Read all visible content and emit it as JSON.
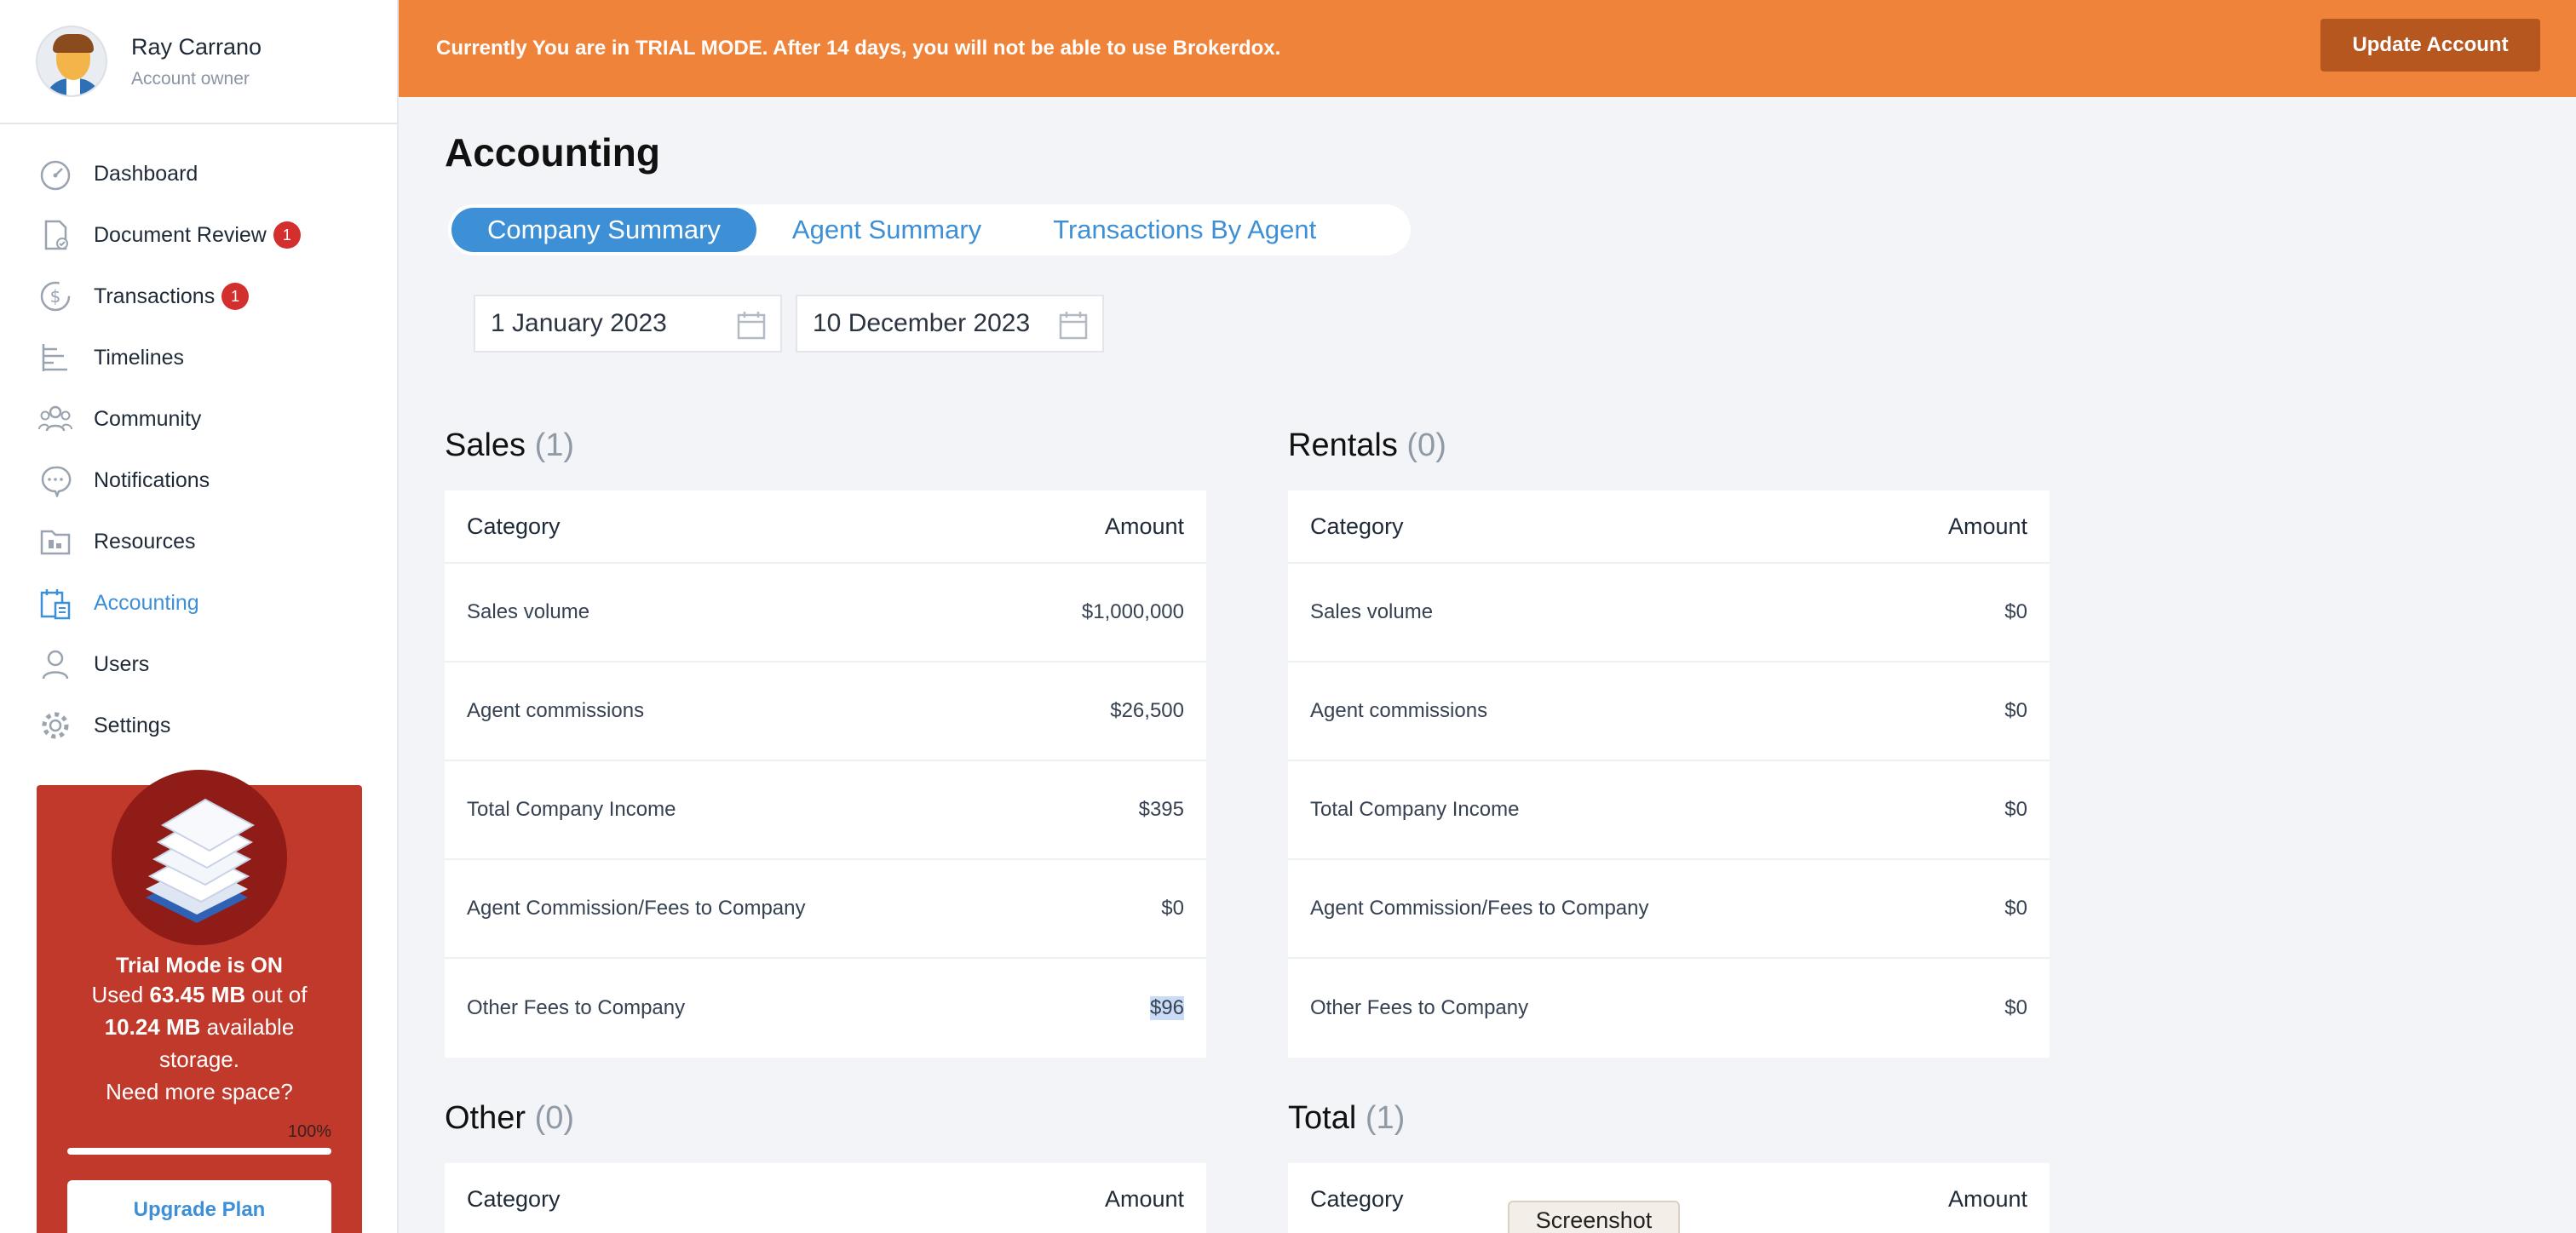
{
  "profile": {
    "name": "Ray Carrano",
    "role": "Account owner"
  },
  "nav": [
    {
      "label": "Dashboard",
      "icon": "speedometer-icon"
    },
    {
      "label": "Document Review",
      "icon": "document-check-icon",
      "badge": "1"
    },
    {
      "label": "Transactions",
      "icon": "dollar-circle-icon",
      "badge": "1"
    },
    {
      "label": "Timelines",
      "icon": "timeline-icon"
    },
    {
      "label": "Community",
      "icon": "people-icon"
    },
    {
      "label": "Notifications",
      "icon": "chat-bubble-icon"
    },
    {
      "label": "Resources",
      "icon": "folder-icon"
    },
    {
      "label": "Accounting",
      "icon": "accounting-icon",
      "active": true
    },
    {
      "label": "Users",
      "icon": "user-icon"
    },
    {
      "label": "Settings",
      "icon": "gear-icon"
    }
  ],
  "trial": {
    "title": "Trial Mode is ON",
    "used_prefix": "Used ",
    "used": "63.45 MB",
    "out_of": " out of",
    "available": "10.24 MB",
    "available_suffix": " available",
    "storage": "storage.",
    "need_more": "Need more space?",
    "progress_label": "100%",
    "progress": 1.0,
    "upgrade_label": "Upgrade Plan"
  },
  "banner": {
    "text": "Currently You are in TRIAL MODE. After 14 days, you will not be able to use Brokerdox.",
    "button": "Update Account"
  },
  "page": {
    "title": "Accounting"
  },
  "tabs": [
    {
      "label": "Company Summary",
      "active": true
    },
    {
      "label": "Agent Summary"
    },
    {
      "label": "Transactions By Agent"
    }
  ],
  "dates": {
    "start": "1 January 2023",
    "end": "10 December 2023"
  },
  "sales": {
    "title": "Sales",
    "count": "(1)",
    "header": [
      "Category",
      "Amount"
    ],
    "rows": [
      [
        "Sales volume",
        "$1,000,000"
      ],
      [
        "Agent commissions",
        "$26,500"
      ],
      [
        "Total Company Income",
        "$395"
      ],
      [
        "Agent Commission/Fees to Company",
        "$0"
      ],
      [
        "Other Fees to Company",
        "$96"
      ]
    ]
  },
  "rentals": {
    "title": "Rentals",
    "count": "(0)",
    "header": [
      "Category",
      "Amount"
    ],
    "rows": [
      [
        "Sales volume",
        "$0"
      ],
      [
        "Agent commissions",
        "$0"
      ],
      [
        "Total Company Income",
        "$0"
      ],
      [
        "Agent Commission/Fees to Company",
        "$0"
      ],
      [
        "Other Fees to Company",
        "$0"
      ]
    ]
  },
  "other": {
    "title": "Other",
    "count": "(0)",
    "header": [
      "Category",
      "Amount"
    ]
  },
  "total": {
    "title": "Total",
    "count": "(1)",
    "header": [
      "Category",
      "Amount"
    ]
  },
  "tooltip": "Screenshot",
  "colors": {
    "banner": "#f0833a",
    "accent": "#3d8fd6",
    "trial_card": "#c0392b",
    "badge": "#d32f2f"
  }
}
